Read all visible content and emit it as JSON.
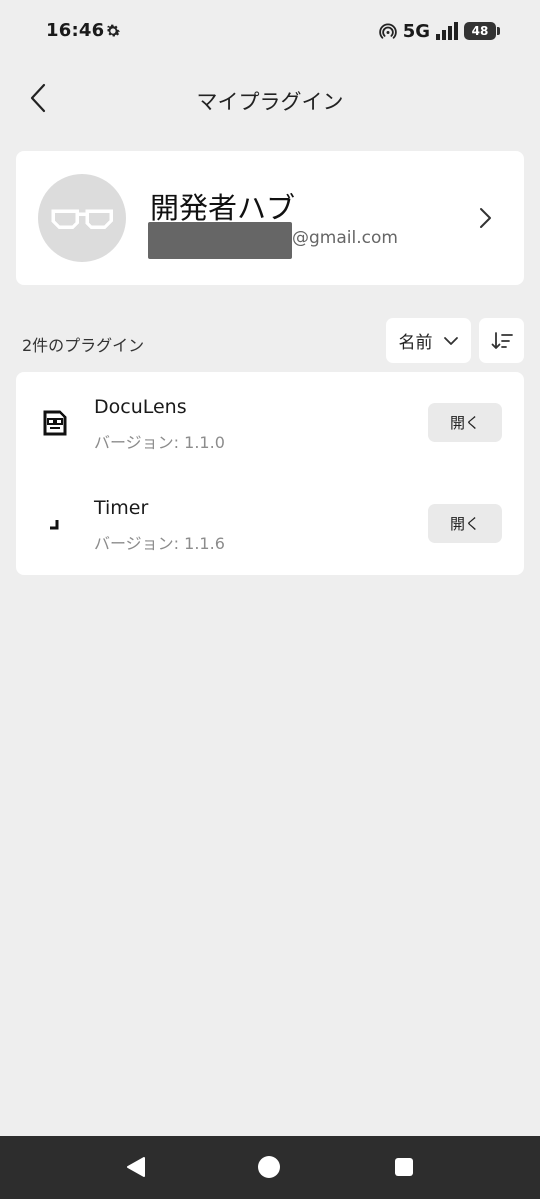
{
  "status_bar": {
    "time": "16:46",
    "network": "5G",
    "battery": "48",
    "icons": [
      "settings-gear-icon",
      "hotspot-icon",
      "signal-icon",
      "battery-icon"
    ]
  },
  "header": {
    "title": "マイプラグイン",
    "back_icon": "chevron-left-icon"
  },
  "profile": {
    "name": "開発者ハブ",
    "email_suffix": "@gmail.com",
    "avatar_icon": "glasses-icon",
    "chevron_icon": "chevron-right-icon"
  },
  "plugins": {
    "count_label": "2件のプラグイン",
    "sort_label": "名前",
    "sort_icons": [
      "chevron-down-icon",
      "sort-order-icon"
    ],
    "items": [
      {
        "name": "DocuLens",
        "version": "バージョン: 1.1.0",
        "button": "開く",
        "icon": "doc-glasses-icon"
      },
      {
        "name": "Timer",
        "version": "バージョン: 1.1.6",
        "button": "開く",
        "icon": "corner-bracket-icon"
      }
    ]
  },
  "nav_bar": {
    "icons": [
      "back-triangle-icon",
      "home-circle-icon",
      "recents-square-icon"
    ]
  },
  "colors": {
    "background": "#eeeeee",
    "card": "#ffffff",
    "button": "#eaeaea",
    "nav": "#2d2d2d"
  }
}
